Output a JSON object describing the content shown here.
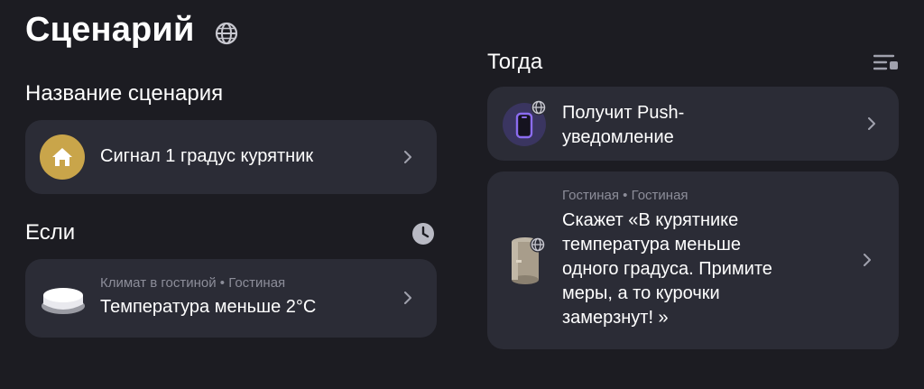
{
  "page": {
    "title": "Сценарий",
    "title_icon": "globe-icon"
  },
  "left": {
    "name_section": {
      "label": "Название сценария",
      "card": {
        "icon": "house-icon",
        "text": "Сигнал 1 градус курятник"
      }
    },
    "if_section": {
      "label": "Если",
      "icon": "clock-icon",
      "card": {
        "icon": "climate-sensor-icon",
        "subtitle_device": "Климат в гостиной",
        "subtitle_room": "Гостиная",
        "separator": "•",
        "text": "Температура меньше 2°C"
      }
    }
  },
  "right": {
    "then_section": {
      "label": "Тогда",
      "icon": "list-settings-icon",
      "actions": [
        {
          "icon": "phone-icon",
          "line1": "Получит Push-",
          "line2": "уведомление"
        },
        {
          "icon": "smart-speaker-icon",
          "subtitle_device": "Гостиная",
          "subtitle_room": "Гостиная",
          "separator": "•",
          "lines": [
            "Скажет «В курятнике",
            "температура меньше",
            "одного градуса. Примите",
            "меры, а то курочки",
            "замерзнут! »"
          ]
        }
      ]
    }
  },
  "colors": {
    "background": "#1c1c22",
    "card": "#2b2c36",
    "muted_text": "#8c8d99",
    "house_badge": "#c9a54a",
    "phone_badge": "#3a3560",
    "phone_accent": "#8b6cf0"
  }
}
